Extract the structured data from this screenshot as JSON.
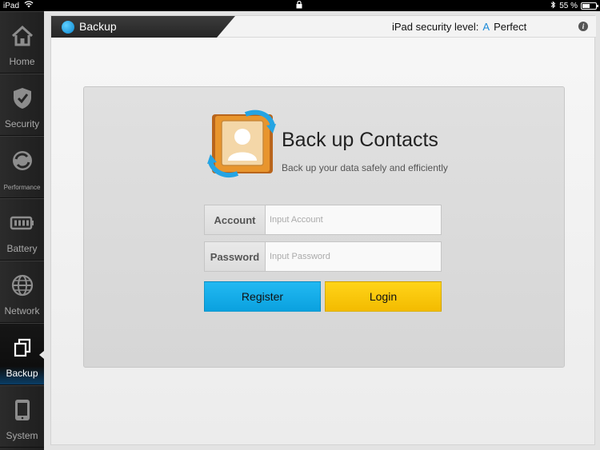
{
  "status": {
    "device": "iPad",
    "battery": "55 %",
    "battery_fraction": 0.55
  },
  "sidebar": {
    "items": [
      {
        "label": "Home",
        "icon": "home-icon",
        "active": false
      },
      {
        "label": "Security",
        "icon": "shield-icon",
        "active": false
      },
      {
        "label": "Performance",
        "icon": "performance-icon",
        "active": false
      },
      {
        "label": "Battery",
        "icon": "battery-icon",
        "active": false
      },
      {
        "label": "Network",
        "icon": "globe-icon",
        "active": false
      },
      {
        "label": "Backup",
        "icon": "backup-icon",
        "active": true
      },
      {
        "label": "System",
        "icon": "device-icon",
        "active": false
      }
    ]
  },
  "header": {
    "title": "Backup",
    "security_label": "iPad security level:",
    "security_grade": "A",
    "security_status": "Perfect"
  },
  "card": {
    "title": "Back up Contacts",
    "subtitle": "Back up your data safely and efficiently",
    "account_label": "Account",
    "account_placeholder": "Input Account",
    "password_label": "Password",
    "password_placeholder": "Input Password",
    "register_label": "Register",
    "login_label": "Login"
  },
  "colors": {
    "accent": "#1a8ad8",
    "register": "#10a9e6",
    "login": "#f7c300"
  }
}
